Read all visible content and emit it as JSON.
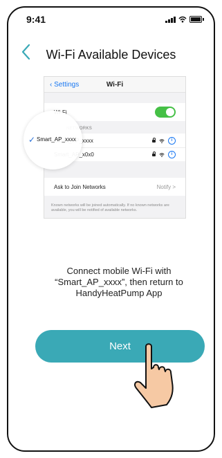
{
  "status_bar": {
    "time": "9:41"
  },
  "header": {
    "title": "Wi-Fi Available Devices"
  },
  "settings_screenshot": {
    "back_label": "Settings",
    "title": "Wi-Fi",
    "wifi_label": "Wi-Fi",
    "section_label": "NETWORKS",
    "networks": [
      "Smart_AP_xxxx",
      "Smart_AP_x0x0"
    ],
    "ask_label": "Ask to Join Networks",
    "notify_label": "Notify >",
    "footnote": "Known networks will be joined automatically. If no known networks are available, you will be notified of available networks.",
    "magnified_network": "Smart_AP_xxxx"
  },
  "instruction": "Connect mobile Wi-Fi with “Smart_AP_xxxx”, then return to HandyHeatPump App",
  "next_button": {
    "label": "Next"
  },
  "colors": {
    "accent": "#3aa9b6",
    "toggle": "#45c046",
    "link": "#1877f2"
  }
}
